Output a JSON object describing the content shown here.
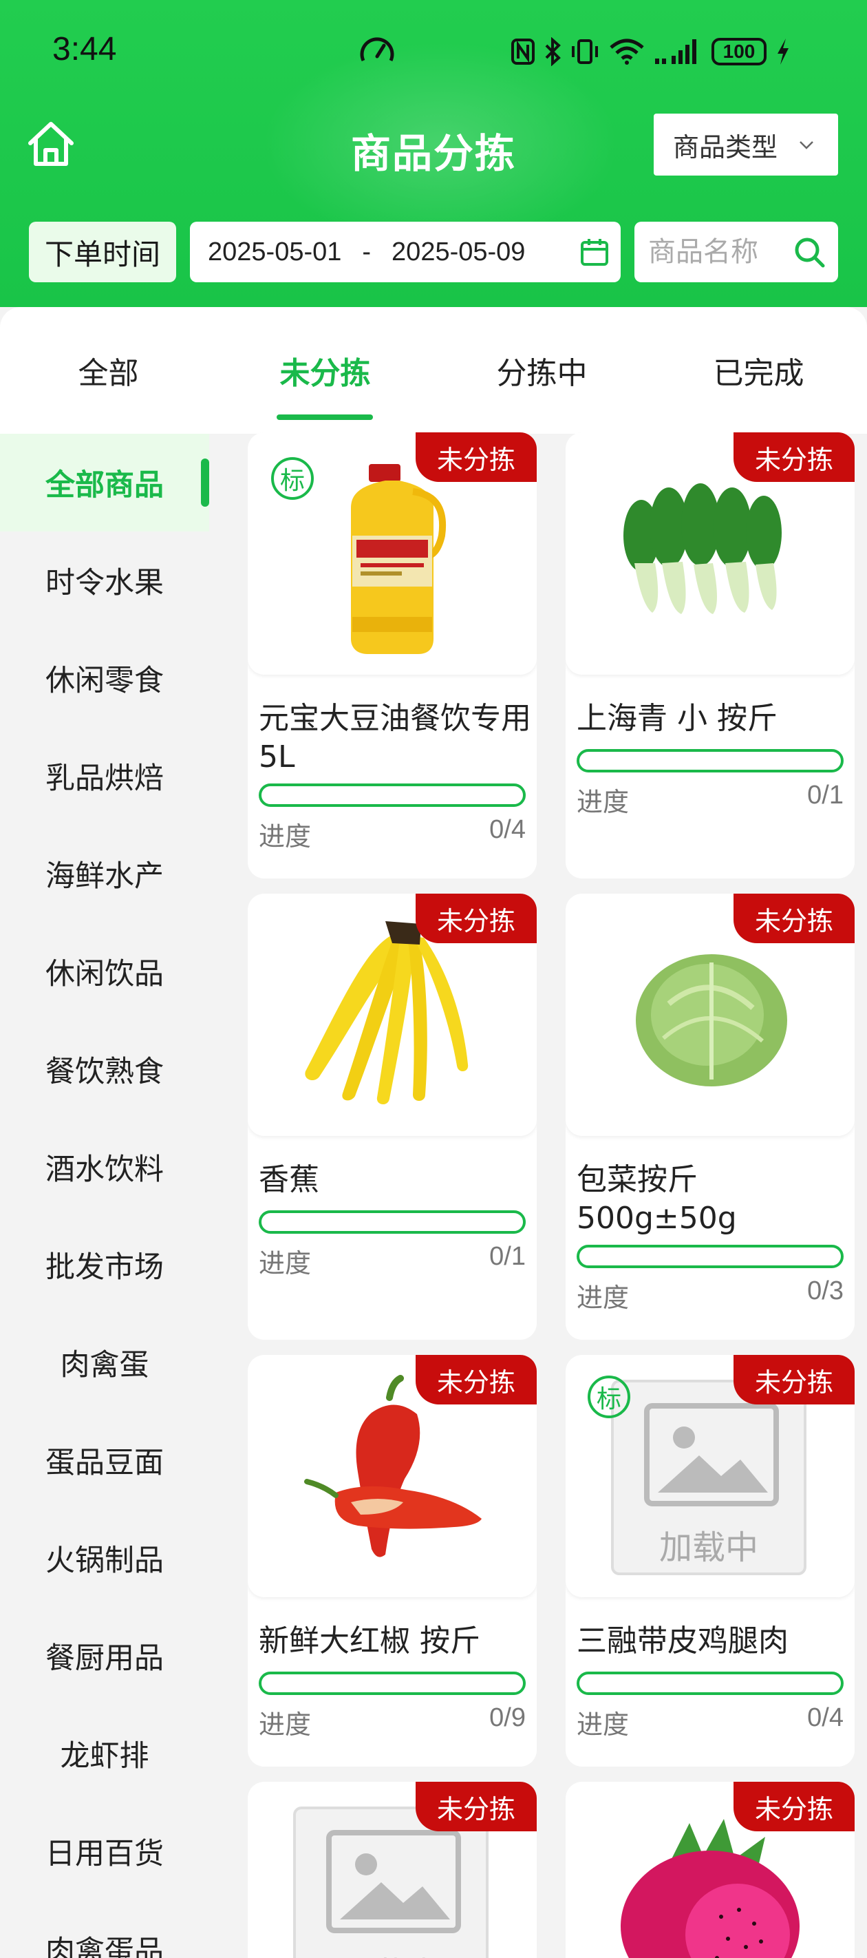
{
  "status_bar": {
    "time": "3:44",
    "battery": "100"
  },
  "header": {
    "title": "商品分拣",
    "type_select_label": "商品类型",
    "order_time_label": "下单时间",
    "date_start": "2025-05-01",
    "date_separator": "-",
    "date_end": "2025-05-09",
    "search_placeholder": "商品名称"
  },
  "tabs": [
    "全部",
    "未分拣",
    "分拣中",
    "已完成"
  ],
  "active_tab": "未分拣",
  "categories": [
    "全部商品",
    "时令水果",
    "休闲零食",
    "乳品烘焙",
    "海鲜水产",
    "休闲饮品",
    "餐饮熟食",
    "酒水饮料",
    "批发市场",
    "肉禽蛋",
    "蛋品豆面",
    "火锅制品",
    "餐厨用品",
    "龙虾排",
    "日用百货",
    "肉禽蛋品"
  ],
  "active_category": "全部商品",
  "progress_label": "进度",
  "standard_mark": "标",
  "loading_text": "加载中",
  "products": [
    {
      "name": "元宝大豆油餐饮专用5L",
      "status": "未分拣",
      "progress": "0/4",
      "image": "soybean-oil-bottle",
      "standard": true
    },
    {
      "name": "上海青 小 按斤",
      "status": "未分拣",
      "progress": "0/1",
      "image": "bok-choy"
    },
    {
      "name": "香蕉",
      "status": "未分拣",
      "progress": "0/1",
      "image": "banana"
    },
    {
      "name": "包菜按斤500g±50g",
      "status": "未分拣",
      "progress": "0/3",
      "image": "cabbage"
    },
    {
      "name": "新鲜大红椒 按斤",
      "status": "未分拣",
      "progress": "0/9",
      "image": "red-pepper"
    },
    {
      "name": "三融带皮鸡腿肉",
      "status": "未分拣",
      "progress": "0/4",
      "image": "loading-placeholder",
      "standard": true
    },
    {
      "name": "",
      "status": "未分拣",
      "progress": "",
      "image": "loading-placeholder"
    },
    {
      "name": "",
      "status": "未分拣",
      "progress": "",
      "image": "dragon-fruit"
    }
  ],
  "colors": {
    "brand_green": "#1ab94a",
    "header_green": "#22cd4f",
    "badge_red": "#c80c0c"
  }
}
